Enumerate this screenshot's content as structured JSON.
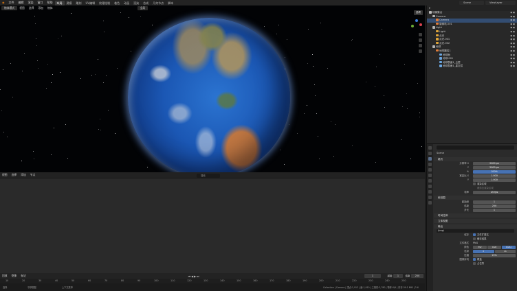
{
  "topbar": {
    "menus": [
      "文件",
      "编辑",
      "渲染",
      "窗口",
      "帮助"
    ],
    "workspaces": [
      "布局",
      "建模",
      "雕刻",
      "UV编辑",
      "纹理绘制",
      "着色",
      "动画",
      "渲染",
      "合成",
      "几何节点",
      "脚本"
    ],
    "active_workspace": "布局",
    "scene": "Scene",
    "view_layer": "ViewLayer"
  },
  "viewport": {
    "header": [
      "物体模式",
      "视图",
      "选择",
      "添加",
      "物体"
    ],
    "orientation": "全局",
    "tooltip": "选项"
  },
  "timeline": {
    "header": [
      "视图",
      "选择",
      "添加",
      "节点"
    ],
    "search_placeholder": "搜索",
    "playbar": [
      "回放",
      "抠像",
      "标记"
    ],
    "current_frame": "1",
    "start_label": "起始",
    "start": "1",
    "end_label": "结束",
    "end": "250",
    "ticks": [
      "10",
      "20",
      "30",
      "40",
      "50",
      "60",
      "70",
      "80",
      "90",
      "100",
      "110",
      "120",
      "130",
      "140",
      "150",
      "160",
      "170",
      "180",
      "190",
      "200",
      "210",
      "220",
      "230",
      "240",
      "250"
    ],
    "status": [
      "选择",
      "平移视图",
      "上下文菜单"
    ],
    "status_right": "Collection | Camera | 顶点:1,912 | 面:1,910 | 三角形:3,780 | 物体:0/6 | 内存:39.1 MiB | 3.6"
  },
  "outliner": {
    "title": "场景集合",
    "rows": [
      {
        "label": "场景集合",
        "indent": 0,
        "color": "#bbbbbb"
      },
      {
        "label": "Camera",
        "indent": 1,
        "color": "#b3b3b3"
      },
      {
        "label": "Camera",
        "indent": 2,
        "color": "#e07c3a",
        "selected": true
      },
      {
        "label": "摄像机.001",
        "indent": 2,
        "color": "#e07c3a"
      },
      {
        "label": "Light",
        "indent": 1,
        "color": "#b3b3b3"
      },
      {
        "label": "Light",
        "indent": 2,
        "color": "#e0a63a"
      },
      {
        "label": "点光",
        "indent": 2,
        "color": "#e0a63a"
      },
      {
        "label": "点光.001",
        "indent": 2,
        "color": "#e0a63a"
      },
      {
        "label": "点光.002",
        "indent": 2,
        "color": "#e0a63a"
      },
      {
        "label": "地球",
        "indent": 1,
        "color": "#b3b3b3"
      },
      {
        "label": "地球圆柱1",
        "indent": 2,
        "color": "#e07c3a"
      },
      {
        "label": "地球面",
        "indent": 3,
        "color": "#6ba6e0"
      },
      {
        "label": "地球.001",
        "indent": 3,
        "color": "#6ba6e0"
      },
      {
        "label": "地球表面1_云层",
        "indent": 3,
        "color": "#6ba6e0"
      },
      {
        "label": "地球表面1_星空层",
        "indent": 3,
        "color": "#6ba6e0"
      }
    ]
  },
  "properties": {
    "crumb": "Scene",
    "format_panel": "格式",
    "rows": [
      {
        "label": "分辨率 X",
        "value": "2000 px"
      },
      {
        "label": "Y",
        "value": "2000 px"
      },
      {
        "label": "%",
        "value": "100%",
        "blue": true
      },
      {
        "label": "宽高比 X",
        "value": "1.000"
      },
      {
        "label": "Y",
        "value": "1.000"
      }
    ],
    "render_region": "渲染区域",
    "crop": "裁剪至渲染区域",
    "fps_label": "帧率",
    "fps": "25 fps",
    "frame_panel": "帧范围",
    "frame_rows": [
      {
        "label": "起始帧",
        "value": "1"
      },
      {
        "label": "结束",
        "value": "250"
      },
      {
        "label": "步长",
        "value": "1"
      }
    ],
    "time_stretch": "时间拉伸",
    "stereo": "立体视图",
    "output_panel": "输出",
    "output_path": "/tmp\\",
    "saving_label": "保存",
    "file_ext": "文件扩展名",
    "cache": "缓存结果",
    "file_format_label": "文件格式",
    "file_format": "PNG",
    "color_label": "颜色",
    "color_options": [
      "BW",
      "RGB",
      "RGBA"
    ],
    "color_active": "RGBA",
    "depth_label": "色深",
    "depth_options": [
      "8",
      "16"
    ],
    "depth_active": "8",
    "compress_label": "压缩",
    "compress": "15%",
    "image_seq_label": "图像序列",
    "overwrite": "覆盖",
    "placeholders": "占位符"
  }
}
